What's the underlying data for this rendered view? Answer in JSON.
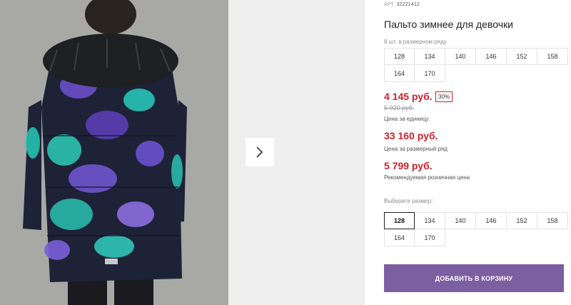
{
  "product": {
    "art_label": "АРТ.",
    "art_value": "32221412",
    "title": "Пальто зимнее для девочки",
    "sizes_note": "8 шт. в размерном ряду",
    "sizes_range": [
      "128",
      "134",
      "140",
      "146",
      "152",
      "158",
      "164",
      "170"
    ]
  },
  "pricing": {
    "unit_price": "4 145 руб.",
    "discount": "30%",
    "old_price": "5 920 руб.",
    "unit_caption": "Цена за единицу",
    "row_price": "33 160 руб.",
    "row_caption": "Цена за размерный ряд",
    "retail_price": "5 799 руб.",
    "retail_caption": "Рекомендуемая розничная цена"
  },
  "size_select": {
    "label": "Выберите размер:",
    "options": [
      "128",
      "134",
      "140",
      "146",
      "152",
      "158",
      "164",
      "170"
    ],
    "selected": "128"
  },
  "actions": {
    "add_to_cart": "ДОБАВИТЬ В КОРЗИНУ"
  },
  "colors": {
    "accent": "#7b5fa0",
    "price_red": "#d22128"
  },
  "icons": {
    "next": "chevron-right-icon"
  }
}
